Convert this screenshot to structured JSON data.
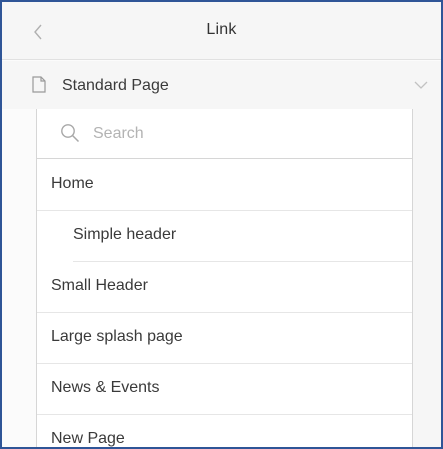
{
  "header": {
    "title": "Link",
    "back_icon": "chevron-left-icon"
  },
  "page_select": {
    "value": "Standard Page",
    "icon": "page-icon",
    "dropdown_icon": "chevron-down-icon"
  },
  "search": {
    "placeholder": "Search",
    "value": ""
  },
  "pages": [
    {
      "label": "Home",
      "level": 0
    },
    {
      "label": "Simple header",
      "level": 1
    },
    {
      "label": "Small Header",
      "level": 0
    },
    {
      "label": "Large splash page",
      "level": 0
    },
    {
      "label": "News & Events",
      "level": 0
    },
    {
      "label": "New Page",
      "level": 0
    }
  ],
  "colors": {
    "frame_border": "#2f5597",
    "header_bg": "#f6f6f6",
    "divider": "#e6e6e6"
  }
}
